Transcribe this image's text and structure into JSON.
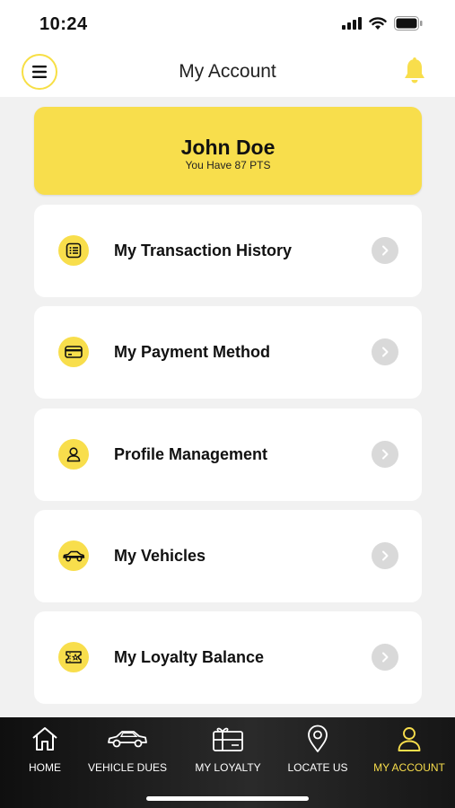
{
  "status": {
    "time": "10:24"
  },
  "header": {
    "title": "My Account"
  },
  "profile": {
    "name": "John Doe",
    "points": "You Have 87 PTS"
  },
  "menu": [
    {
      "label": "My Transaction History",
      "icon": "list-icon"
    },
    {
      "label": "My Payment Method",
      "icon": "credit-card-icon"
    },
    {
      "label": "Profile Management",
      "icon": "user-icon"
    },
    {
      "label": "My Vehicles",
      "icon": "car-icon"
    },
    {
      "label": "My Loyalty Balance",
      "icon": "ticket-icon"
    }
  ],
  "tabs": [
    {
      "label": "HOME",
      "icon": "home-icon"
    },
    {
      "label": "VEHICLE DUES",
      "icon": "car-icon"
    },
    {
      "label": "MY LOYALTY",
      "icon": "gift-card-icon"
    },
    {
      "label": "LOCATE US",
      "icon": "location-pin-icon"
    },
    {
      "label": "MY ACCOUNT",
      "icon": "user-icon",
      "active": true
    }
  ],
  "colors": {
    "accent": "#f8de4c",
    "background": "#f1f1f1",
    "tabbar": "#1a1a1a"
  }
}
